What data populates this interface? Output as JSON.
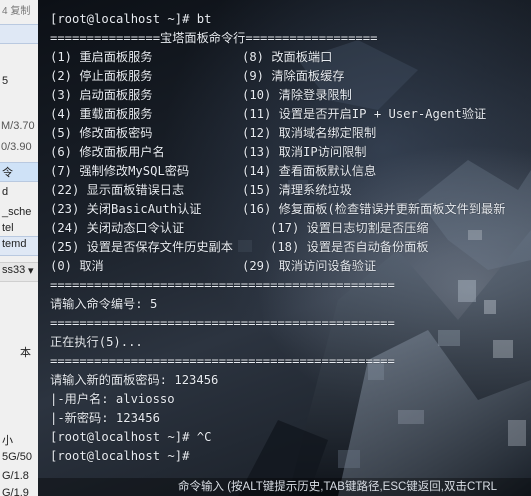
{
  "left_panel": {
    "top_text": "4 复制",
    "items": [
      "5",
      "M/3.70",
      "0/3.90",
      "令",
      "d",
      "_sche",
      "tel",
      "temd",
      "ss33",
      "本",
      "小",
      "5G/50",
      "G/1.8",
      "G/1.9"
    ]
  },
  "terminal": {
    "prompt1": "[root@localhost ~]# bt",
    "menu_header": "===============宝塔面板命令行==================",
    "menu": [
      {
        "left": "(1) 重启面板服务",
        "right": "(8) 改面板端口"
      },
      {
        "left": "(2) 停止面板服务",
        "right": "(9) 清除面板缓存"
      },
      {
        "left": "(3) 启动面板服务",
        "right": "(10) 清除登录限制"
      },
      {
        "left": "(4) 重载面板服务",
        "right": "(11) 设置是否开启IP + User-Agent验证"
      },
      {
        "left": "(5) 修改面板密码",
        "right": "(12) 取消域名绑定限制"
      },
      {
        "left": "(6) 修改面板用户名",
        "right": "(13) 取消IP访问限制"
      },
      {
        "left": "(7) 强制修改MySQL密码",
        "right": "(14) 查看面板默认信息"
      },
      {
        "left": "(22) 显示面板错误日志",
        "right": "(15) 清理系统垃圾"
      },
      {
        "left": "(23) 关闭BasicAuth认证",
        "right": "(16) 修复面板(检查错误并更新面板文件到最新"
      },
      {
        "left": "(24) 关闭动态口令认证",
        "right": "(17) 设置日志切割是否压缩"
      },
      {
        "left": "(25) 设置是否保存文件历史副本",
        "right": "(18) 设置是否自动备份面板"
      },
      {
        "left": "(0) 取消",
        "right": "(29) 取消访问设备验证"
      }
    ],
    "sep": "===============================================",
    "input_prompt": "请输入命令编号: 5",
    "executing": "正在执行(5)...",
    "new_pwd": "请输入新的面板密码: 123456",
    "user_line": "|-用户名: alviosso",
    "pwd_line": "|-新密码: 123456",
    "prompt2": "[root@localhost ~]# ^C",
    "prompt3": "[root@localhost ~]#"
  },
  "statusbar": {
    "text": "命令输入 (按ALT键提示历史,TAB键路径,ESC键返回,双击CTRL"
  }
}
